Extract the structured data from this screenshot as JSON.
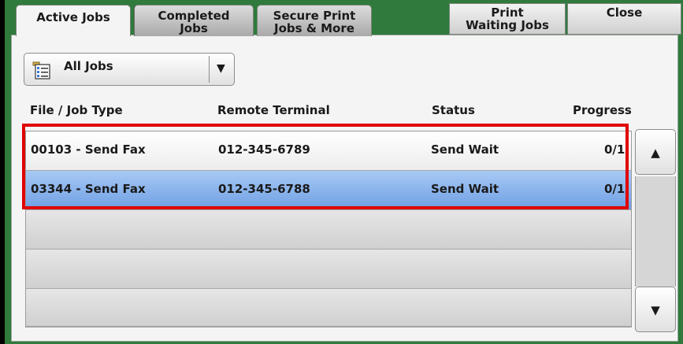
{
  "tabs": [
    {
      "label_line1": "Active Jobs",
      "label_line2": ""
    },
    {
      "label_line1": "Completed",
      "label_line2": "Jobs"
    },
    {
      "label_line1": "Secure Print",
      "label_line2": "Jobs & More"
    }
  ],
  "top_buttons": {
    "print_waiting_line1": "Print",
    "print_waiting_line2": "Waiting Jobs",
    "close": "Close"
  },
  "filter": {
    "selected": "All Jobs",
    "icon": "job-list-icon"
  },
  "columns": [
    "File / Job Type",
    "Remote Terminal",
    "Status",
    "Progress"
  ],
  "jobs": [
    {
      "file": "00103 - Send Fax",
      "terminal": "012-345-6789",
      "status": "Send Wait",
      "progress": "0/1",
      "selected": false
    },
    {
      "file": "03344 - Send Fax",
      "terminal": "012-345-6788",
      "status": "Send Wait",
      "progress": "0/1",
      "selected": true
    }
  ],
  "scroll": {
    "up": "▲",
    "down": "▼"
  },
  "colors": {
    "frame_green": "#2f7a3c",
    "selected_row": "#6e9fe3",
    "highlight_box": "#e00000"
  }
}
